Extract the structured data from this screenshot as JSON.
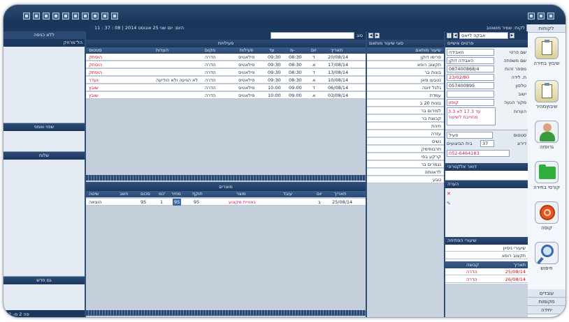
{
  "window": {
    "title": "לקוח: שמיר מושונוב",
    "status_date": "היום: יום שני 25 אוגוסט 2014 | 08 : 37 : 11"
  },
  "right_nav": {
    "title": "לקוחות",
    "items": [
      {
        "label": "שיבוץ בחירה",
        "icon": "clipboard-icon"
      },
      {
        "label": "שיבוץמהיר",
        "icon": "clipboard-icon"
      },
      {
        "label": "גרופזה",
        "icon": "user-icon"
      },
      {
        "label": "קורסי בחירה",
        "icon": "folder-icon"
      },
      {
        "label": "קופה",
        "icon": "coin-icon"
      },
      {
        "label": "חיפוש",
        "icon": "search-icon"
      }
    ],
    "bottom_tabs": [
      "עובדים",
      "מקומות",
      "יחידה"
    ]
  },
  "client_panel": {
    "header": "פרטים אישיים",
    "nav_text": "אבקה לייאס",
    "fields": [
      {
        "label": "שם פרטי",
        "value": "האבידה"
      },
      {
        "label": "שם משפחה",
        "value": "האבידה דוקן"
      },
      {
        "label": "מספר זהות",
        "value": "087400868/4"
      },
      {
        "label": "ת. לידה",
        "value": "23/02/80"
      },
      {
        "label": "טלפון",
        "value": "057400895"
      },
      {
        "label": "ישוב",
        "value": ""
      },
      {
        "label": "מקור הגעה",
        "value": "קופון"
      }
    ],
    "notes_label": "הערות",
    "notes_value": "3.3 עד 17.3 לא מחוייבת לשיעור",
    "rank_label": "דירוג",
    "rank_value": "37",
    "house_label": "בית הביצועים",
    "status_label": "סטטוס",
    "status_value": "פעיל",
    "phone_value": "052-6464183",
    "email_header": "דואר אלקטרוני",
    "notes_header": "הערה",
    "lessons_header": "שיעורי הפתיחה",
    "lesson_items": [
      "שיעורי ניסיון",
      "תקצוב רופא"
    ],
    "date_col": "תאריך",
    "dates": [
      "25/08/14",
      "26/08/14"
    ],
    "mid_label": "קבוצה",
    "groups": [
      "הדרה",
      "הדרה"
    ]
  },
  "lessons_list": {
    "header": "סוגי שיעור מותאם",
    "col_title": "שיעור מותאם",
    "items": [
      "פרימו דוקן",
      "תקצוב רופא",
      "בונות בר",
      "נטבעו מאן",
      "גלגל זיונה",
      "עמדת",
      "בונות 20 ב",
      "למירום בר",
      "קבוצת בר",
      "וזיהת",
      "עזרה",
      "נשים",
      "תרבותימק",
      "קרקע בפי",
      "נגמרים בר",
      "לדאוותה",
      "טבע"
    ]
  },
  "activities": {
    "header": "פעילויות",
    "filter_label": "סוג",
    "columns": [
      "סטטוס",
      "הערות",
      "מקום",
      "פעילות",
      "עד",
      "מ-",
      "יום",
      "תאריך"
    ],
    "rows": [
      {
        "status": "הוסתק",
        "notes": "",
        "place": "הדרה",
        "activity": "פילאטיס",
        "to": "09:30",
        "from": "08:30",
        "day": "ד",
        "date": "20/08/14"
      },
      {
        "status": "הוסתק",
        "notes": "",
        "place": "הדרה",
        "activity": "פילאטיס",
        "to": "09:30",
        "from": "08:30",
        "day": "א",
        "date": "17/08/14"
      },
      {
        "status": "הוסתק",
        "notes": "",
        "place": "הדרה",
        "activity": "פילאטיס",
        "to": "09:30",
        "from": "08:30",
        "day": "ד",
        "date": "13/08/14"
      },
      {
        "status": "נעדר",
        "notes": "לא הגיעה ולא הודיעה",
        "place": "הדרה",
        "activity": "פילאטיס",
        "to": "09:30",
        "from": "08:30",
        "day": "א",
        "date": "10/08/14"
      },
      {
        "status": "שובץ",
        "notes": "",
        "place": "הדרה",
        "activity": "פילאטיס",
        "to": "10:00",
        "from": "09:00",
        "day": "ד",
        "date": "06/08/14"
      },
      {
        "status": "שובץ",
        "notes": "",
        "place": "הדרה",
        "activity": "פילאטיס",
        "to": "10:00",
        "from": "09:00",
        "day": "א",
        "date": "03/08/14"
      }
    ]
  },
  "purchases": {
    "header": "מוצרים",
    "columns": [
      "שיטה",
      "חשב",
      "סכום",
      "כמ'",
      "מחיר",
      "תוקף",
      "מוצר",
      "עובד",
      "יום",
      "תאריך"
    ],
    "rows": [
      {
        "method": "הוצאה",
        "calc": "",
        "sum": "95",
        "qty": "1",
        "price": "95",
        "valid": "95",
        "product": "גאוויית מקצוע",
        "worker": "",
        "day": "ב",
        "date": "25/08/14"
      }
    ]
  },
  "left_panel": {
    "header_top": "ללא כניסה",
    "field1": "הל־מרחק",
    "section_a": "שפוי ואמני",
    "section_b": "שלוח",
    "bottom_header": "גם חדש"
  },
  "footer": {
    "left": "פה 2 מ- 52"
  }
}
